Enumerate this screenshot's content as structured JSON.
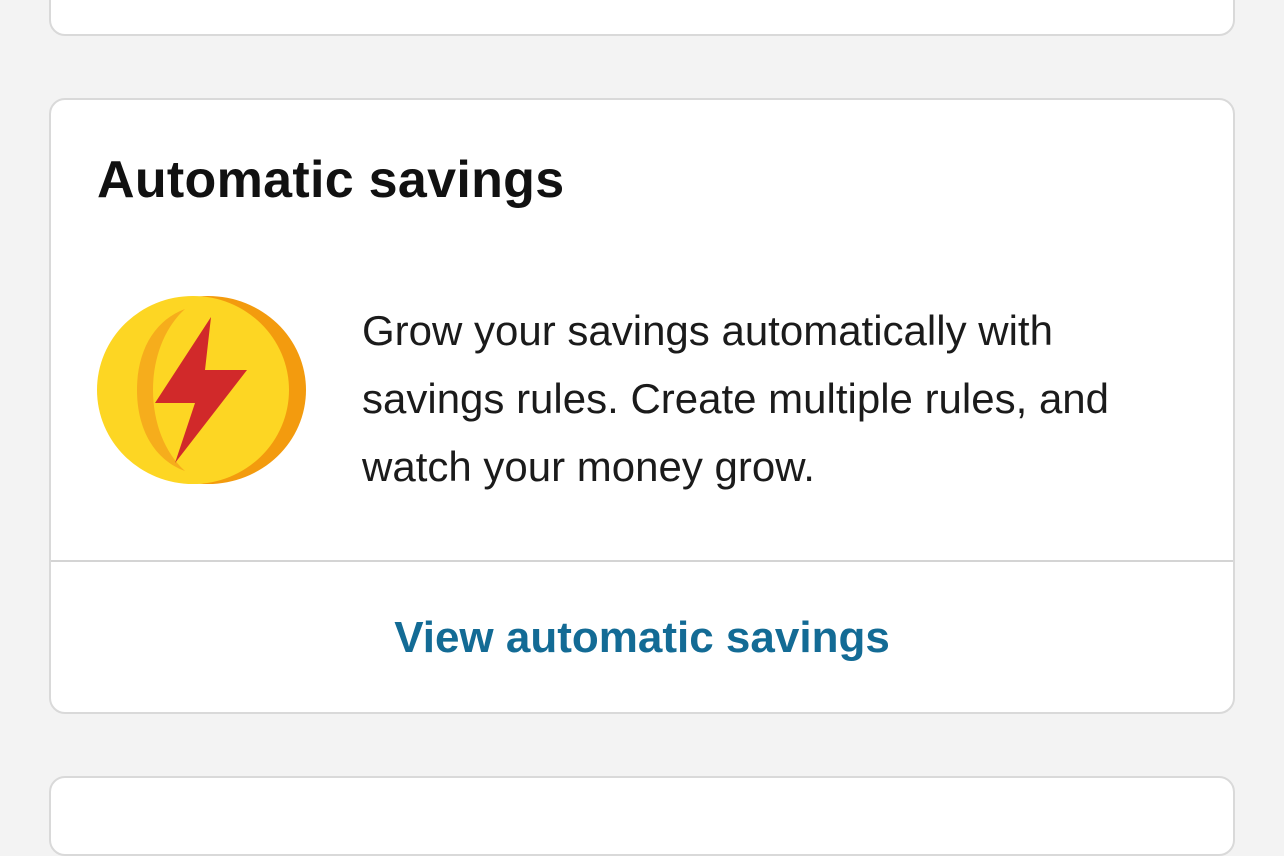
{
  "savings_card": {
    "title": "Automatic savings",
    "icon": "lightning-coin-icon",
    "description": "Grow your savings automatically with savings rules. Create multiple rules, and watch your money grow.",
    "link_label": "View automatic savings"
  },
  "colors": {
    "link": "#136b95",
    "coin_yellow": "#fdd623",
    "coin_orange": "#f39b0e",
    "bolt_red": "#d1292a",
    "page_background": "#f3f3f3",
    "card_border": "#d9d9d9"
  }
}
